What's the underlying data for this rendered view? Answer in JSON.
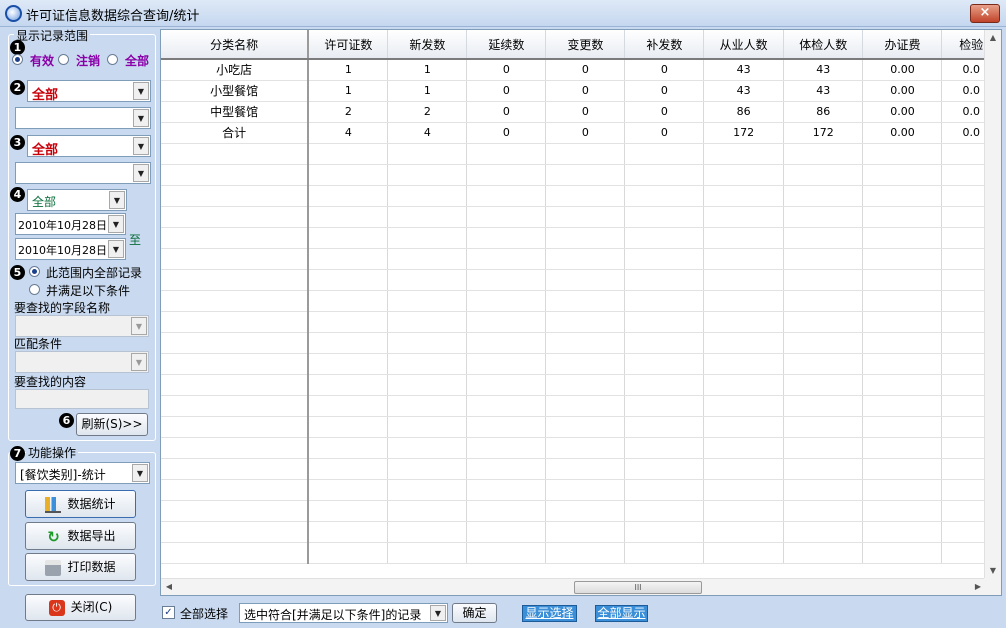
{
  "window": {
    "title": "许可证信息数据综合查询/统计",
    "close": "×"
  },
  "filter": {
    "group_title": "显示记录范围",
    "steps": [
      "1",
      "2",
      "3",
      "4",
      "5",
      "6",
      "7"
    ],
    "status": {
      "options": [
        "有效",
        "注销",
        "全部"
      ],
      "selected": "有效"
    },
    "combo2_value": "全部",
    "combo2b_value": "",
    "combo3_value": "全部",
    "combo3b_value": "",
    "combo4_value": "全部",
    "date_start": "2010年10月28日",
    "date_end": "2010年10月28日",
    "date_to": "至",
    "scope": {
      "all": "此范围内全部记录",
      "cond": "并满足以下条件",
      "selected": "all"
    },
    "field_label": "要查找的字段名称",
    "match_label": "匹配条件",
    "content_label": "要查找的内容",
    "refresh": "刷新(S)>>"
  },
  "ops": {
    "title": "功能操作",
    "mode_value": "[餐饮类别]-统计",
    "stat_button": "数据统计",
    "export_button": "数据导出",
    "print_button": "打印数据",
    "close_button": "关闭(C)"
  },
  "table": {
    "columns": [
      "分类名称",
      "许可证数",
      "新发数",
      "延续数",
      "变更数",
      "补发数",
      "从业人数",
      "体检人数",
      "办证费",
      "检验"
    ],
    "rows": [
      [
        "小吃店",
        "1",
        "1",
        "0",
        "0",
        "0",
        "43",
        "43",
        "0.00",
        "0.0"
      ],
      [
        "小型餐馆",
        "1",
        "1",
        "0",
        "0",
        "0",
        "43",
        "43",
        "0.00",
        "0.0"
      ],
      [
        "中型餐馆",
        "2",
        "2",
        "0",
        "0",
        "0",
        "86",
        "86",
        "0.00",
        "0.0"
      ],
      [
        "合计",
        "4",
        "4",
        "0",
        "0",
        "0",
        "172",
        "172",
        "0.00",
        "0.0"
      ]
    ],
    "thumb_grip": "III"
  },
  "bottom": {
    "select_all": "全部选择",
    "select_all_checked": true,
    "criteria_value": "选中符合[并满足以下条件]的记录",
    "confirm": "确定",
    "show_selected": "显示选择",
    "show_all": "全部显示"
  },
  "colors": {
    "accent": "#3a8fd8",
    "warning_red": "#c8000a",
    "panel_bg": "#c9daf0"
  }
}
